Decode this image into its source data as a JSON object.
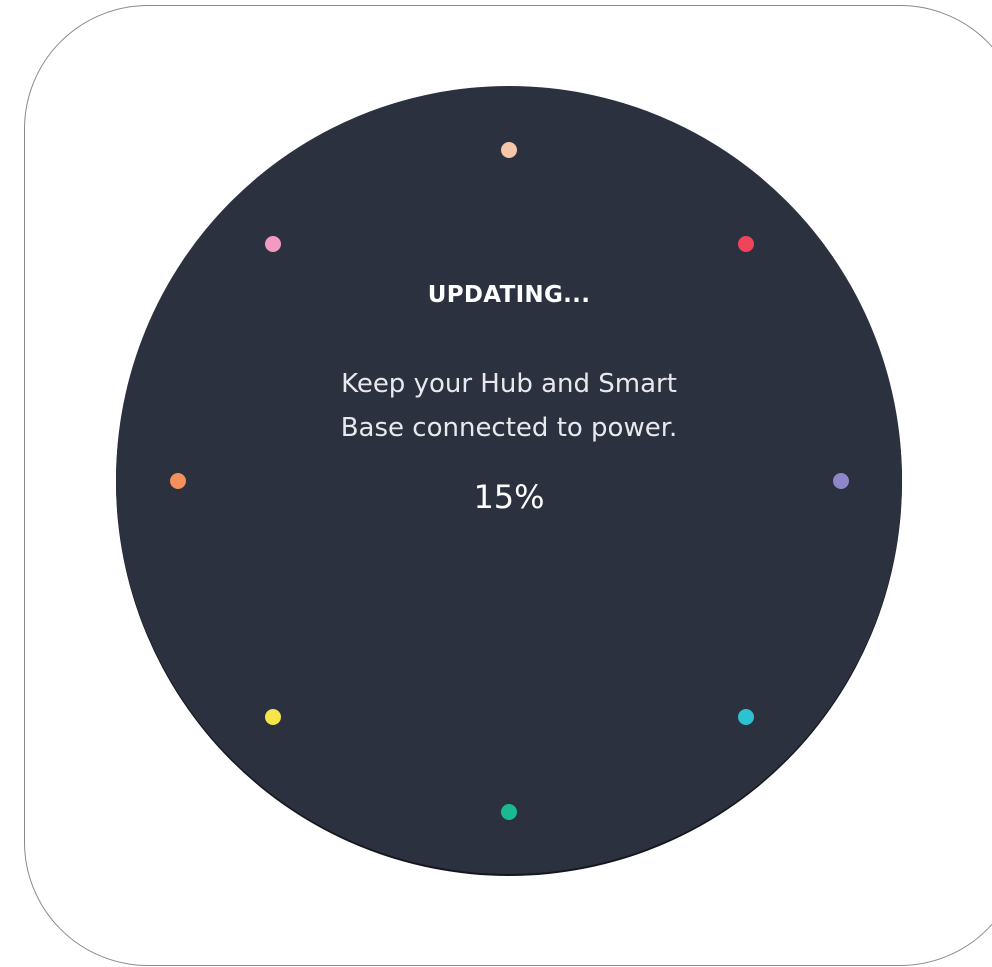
{
  "screen": {
    "background_color": "#2c3140",
    "title": "UPDATING...",
    "message_line_1": "Keep your Hub and Smart",
    "message_line_2": "Base connected to power.",
    "progress_text": "15%",
    "progress": 0.15
  },
  "indicator_dots": [
    {
      "name": "dot-top",
      "color": "#f6c6a8"
    },
    {
      "name": "dot-top-right",
      "color": "#f0445a"
    },
    {
      "name": "dot-right",
      "color": "#8f86c9"
    },
    {
      "name": "dot-bottom-right",
      "color": "#2cc2d2"
    },
    {
      "name": "dot-bottom",
      "color": "#1ab98f"
    },
    {
      "name": "dot-bottom-left",
      "color": "#f5e44a"
    },
    {
      "name": "dot-left",
      "color": "#f6905a"
    },
    {
      "name": "dot-top-left",
      "color": "#f29ac4"
    }
  ]
}
